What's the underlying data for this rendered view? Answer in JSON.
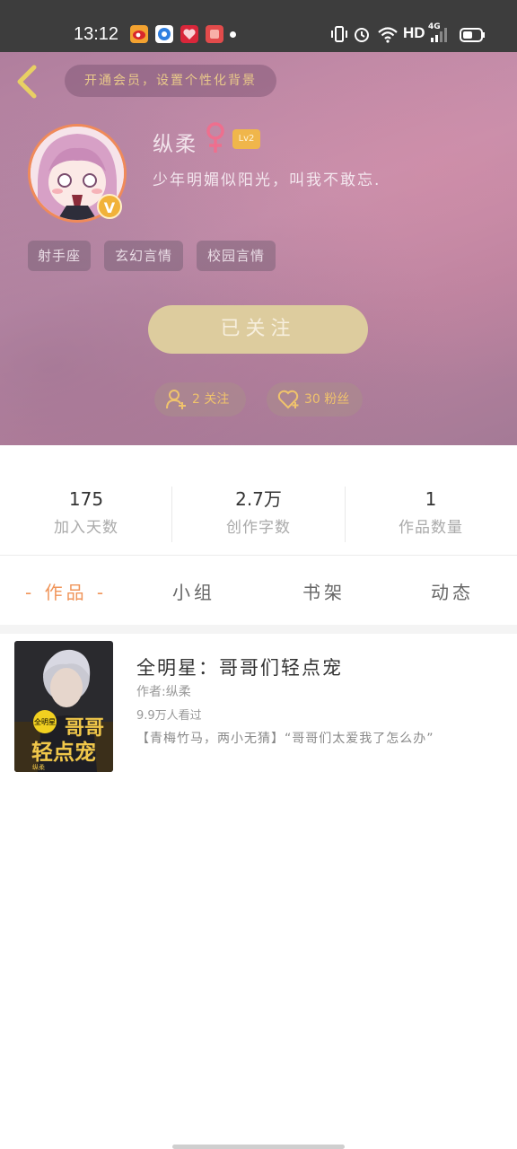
{
  "status_bar": {
    "time": "13:12",
    "network": "HD",
    "signal_tag": "4G",
    "app_icons": [
      "weibo-icon",
      "browser-icon",
      "heart-app-icon",
      "red-app-icon"
    ],
    "app_colors": [
      "#f3a230",
      "#2f7fe0",
      "#d9263a",
      "#e24b4b"
    ]
  },
  "header": {
    "vip_banner": "开通会员，设置个性化背景",
    "username": "纵柔",
    "level": "Lv2",
    "bio": "少年明媚似阳光，叫我不敢忘.",
    "badge": "V",
    "tags": [
      "射手座",
      "玄幻言情",
      "校园言情"
    ],
    "follow_button": "已关注",
    "following": "2 关注",
    "fans": "30 粉丝"
  },
  "stats": [
    {
      "value": "175",
      "label": "加入天数"
    },
    {
      "value": "2.7万",
      "label": "创作字数"
    },
    {
      "value": "1",
      "label": "作品数量"
    }
  ],
  "tabs": [
    "- 作品 -",
    "小组",
    "书架",
    "动态"
  ],
  "book": {
    "title": "全明星：哥哥们轻点宠",
    "author": "作者:纵柔",
    "views": "9.9万人看过",
    "description": "【青梅竹马，两小无猜】“哥哥们太爱我了怎么办”",
    "cover_text_1": "哥哥",
    "cover_text_2": "轻点宠",
    "cover_badge": "全明星",
    "cover_tag": "纵柔"
  },
  "colors": {
    "accent": "#f0955a",
    "gold": "#f0c36c",
    "follow_button": "#ddcc9e",
    "header_bg": "#b88aa6"
  }
}
